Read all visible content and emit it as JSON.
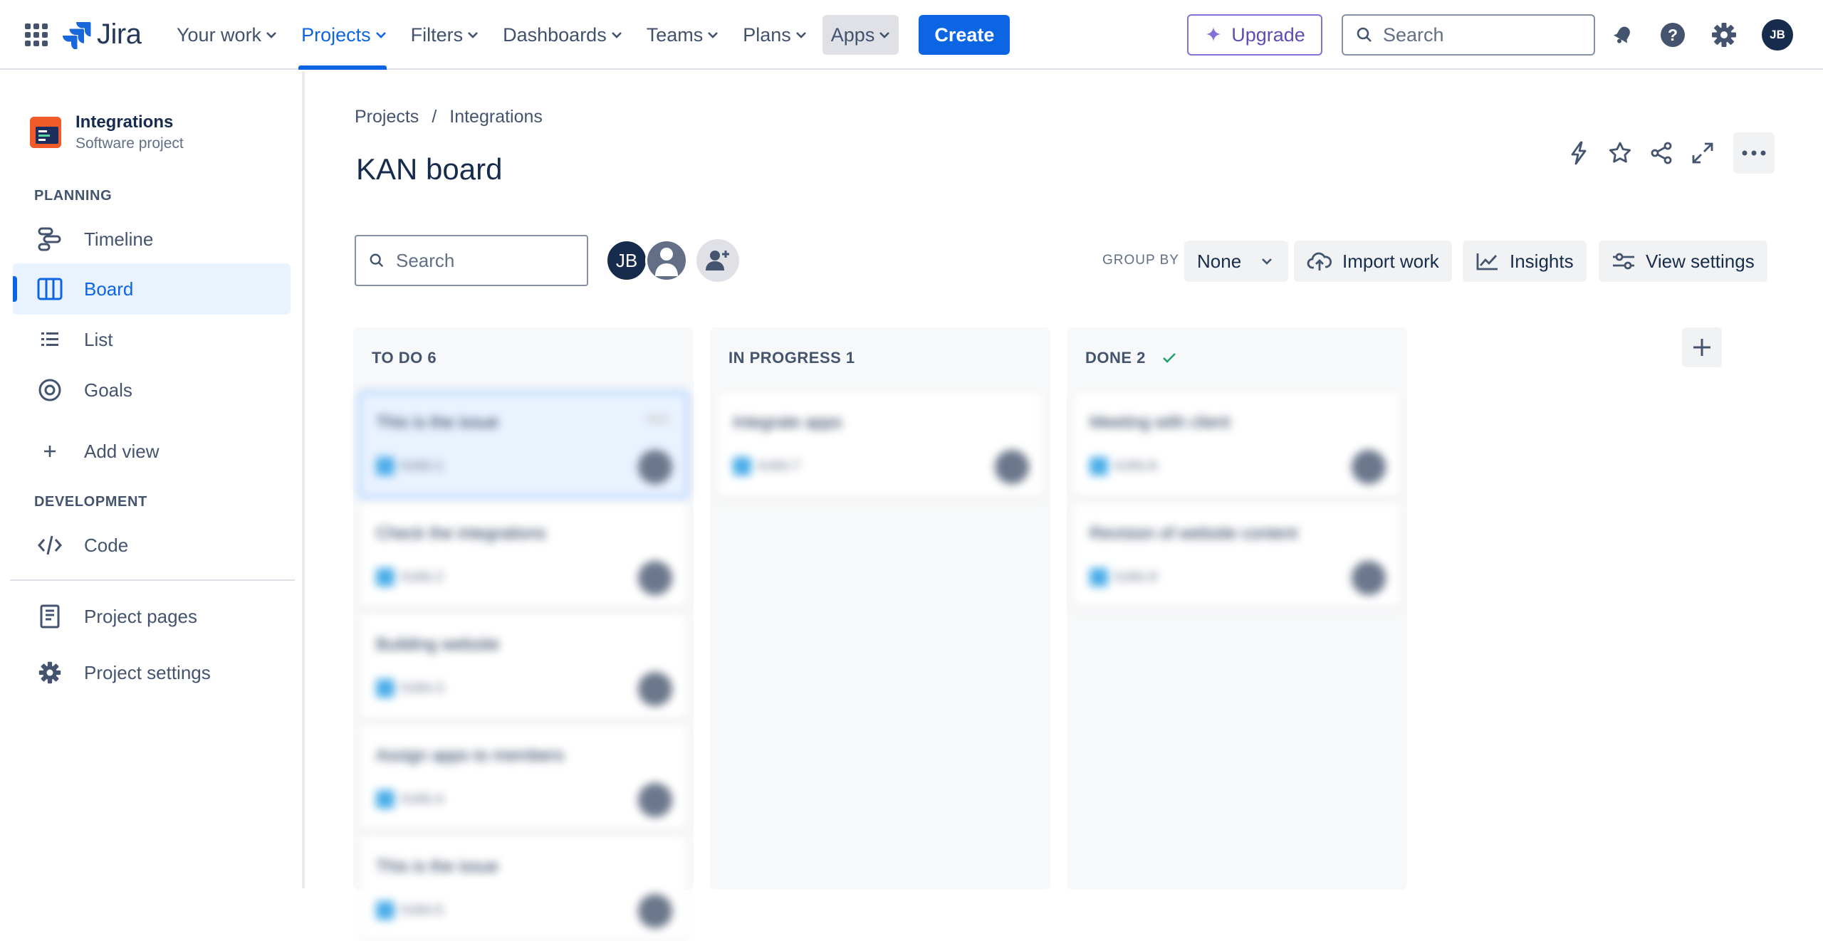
{
  "topnav": {
    "logo_text": "Jira",
    "items": [
      {
        "label": "Your work"
      },
      {
        "label": "Projects"
      },
      {
        "label": "Filters"
      },
      {
        "label": "Dashboards"
      },
      {
        "label": "Teams"
      },
      {
        "label": "Plans"
      },
      {
        "label": "Apps"
      }
    ],
    "create_label": "Create",
    "upgrade_label": "Upgrade",
    "search_placeholder": "Search",
    "avatar_initials": "JB"
  },
  "sidebar": {
    "project_name": "Integrations",
    "project_type": "Software project",
    "planning_heading": "PLANNING",
    "planning_items": [
      {
        "label": "Timeline",
        "icon": "timeline-icon"
      },
      {
        "label": "Board",
        "icon": "board-icon",
        "selected": true
      },
      {
        "label": "List",
        "icon": "list-icon"
      },
      {
        "label": "Goals",
        "icon": "goals-icon"
      }
    ],
    "add_view_label": "Add view",
    "development_heading": "DEVELOPMENT",
    "code_label": "Code",
    "project_pages_label": "Project pages",
    "project_settings_label": "Project settings"
  },
  "main": {
    "breadcrumb": [
      "Projects",
      "Integrations"
    ],
    "breadcrumb_sep": "/",
    "title": "KAN board",
    "search_placeholder": "Search",
    "avatar_initials": "JB",
    "group_by_label": "GROUP BY",
    "group_by_value": "None",
    "import_label": "Import work",
    "insights_label": "Insights",
    "view_settings_label": "View settings"
  },
  "columns": [
    {
      "heading": "TO DO 6",
      "done_check": false,
      "cards": [
        {
          "title": "This is the issue",
          "key": "KAN-1",
          "selected": true
        },
        {
          "title": "Check the integrations",
          "key": "KAN-2"
        },
        {
          "title": "Building website",
          "key": "KAN-3"
        },
        {
          "title": "Assign apps to members",
          "key": "KAN-4"
        },
        {
          "title": "This is the issue",
          "key": "KAN-5"
        }
      ]
    },
    {
      "heading": "IN PROGRESS 1",
      "done_check": false,
      "cards": [
        {
          "title": "Integrate apps",
          "key": "KAN-7"
        }
      ]
    },
    {
      "heading": "DONE 2",
      "done_check": true,
      "cards": [
        {
          "title": "Meeting with client",
          "key": "KAN-8"
        },
        {
          "title": "Revision of website content",
          "key": "KAN-9"
        }
      ]
    }
  ],
  "colors": {
    "accent": "#0C66E4",
    "upgrade": "#8270DB",
    "text": "#172B4D"
  }
}
